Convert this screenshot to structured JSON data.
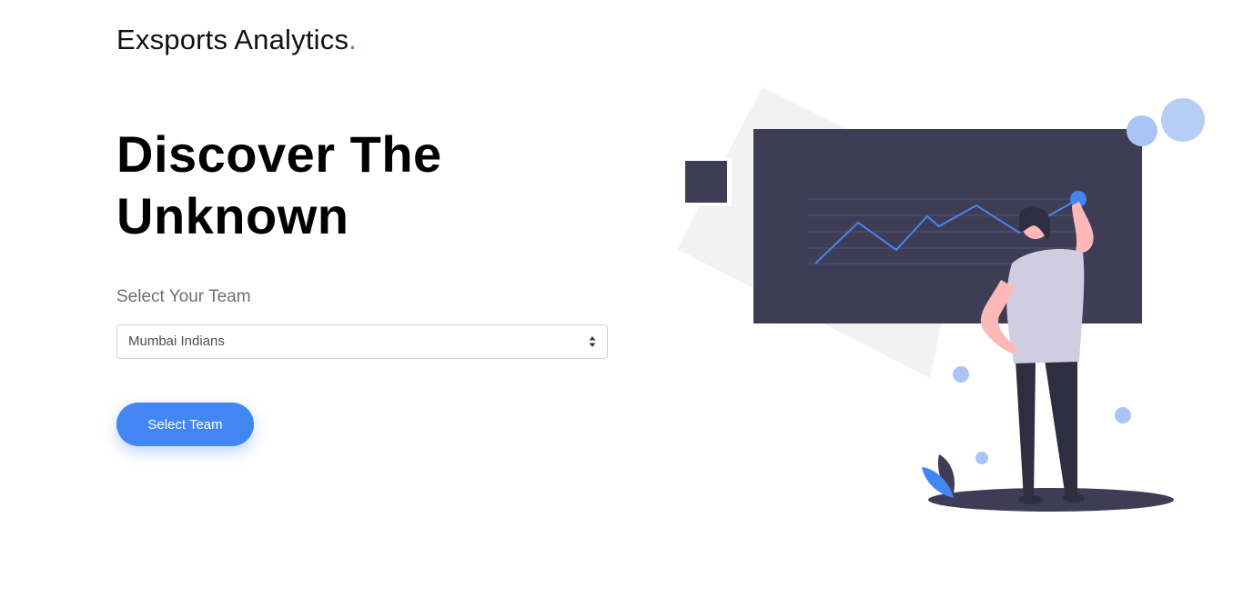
{
  "brand": {
    "name": "Exsports Analytics",
    "dot": "."
  },
  "hero": {
    "line1": "Discover The",
    "line2": "Unknown"
  },
  "team_picker": {
    "label": "Select Your Team",
    "selected": "Mumbai Indians"
  },
  "actions": {
    "select_button": "Select Team"
  },
  "colors": {
    "accent": "#3b82f6",
    "button": "#4286f4",
    "board": "#3f3d56",
    "backdrop": "#f2f2f2",
    "bubble": "#a9c5f5"
  }
}
